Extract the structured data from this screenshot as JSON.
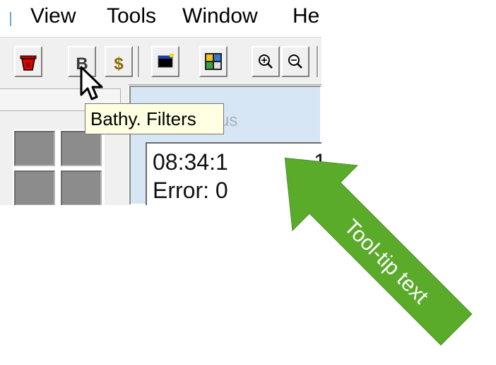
{
  "menubar": {
    "items": [
      "View",
      "Tools",
      "Window",
      "He"
    ]
  },
  "toolbar": {
    "buttons": [
      {
        "icon": "red-bucket-icon"
      },
      {
        "icon": "bathy-filter-icon",
        "label": "B"
      },
      {
        "icon": "dollar-icon",
        "label": "$"
      },
      {
        "icon": "black-window-icon"
      },
      {
        "icon": "color-grid-icon"
      },
      {
        "icon": "zoom-in-icon"
      },
      {
        "icon": "zoom-out-icon"
      }
    ]
  },
  "tooltip": {
    "text": "Bathy. Filters"
  },
  "status_panel": {
    "title_fragment": "us",
    "lines": [
      "08:34:1",
      "Error: 0"
    ],
    "line_tail": "1"
  },
  "callout": {
    "text": "Tool-tip text",
    "color": "#5aab2a"
  }
}
